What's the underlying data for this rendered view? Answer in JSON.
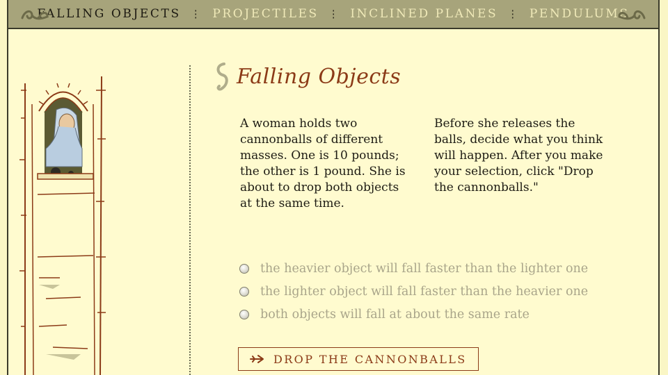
{
  "nav": {
    "items": [
      {
        "label": "FALLING OBJECTS",
        "active": true
      },
      {
        "label": "PROJECTILES",
        "active": false
      },
      {
        "label": "INCLINED PLANES",
        "active": false
      },
      {
        "label": "PENDULUMS",
        "active": false
      }
    ],
    "separator": "⋮"
  },
  "main": {
    "title": "Falling Objects",
    "paragraph1": "A woman holds two cannonballs of different masses. One is 10 pounds; the other is 1 pound. She is about to drop both objects at the same time.",
    "paragraph2": "Before she releases the balls, decide what you think will happen. After you make your selection, click \"Drop the cannonballs.\"",
    "options": [
      "the heavier object will fall faster than the lighter one",
      "the lighter object will fall faster than the heavier one",
      "both objects will fall at about the same rate"
    ],
    "button_label": "DROP THE CANNONBALLS"
  },
  "colors": {
    "background": "#fffbcf",
    "nav_bar": "#a7a47b",
    "title": "#8b3a17",
    "option_text": "#a9a58a"
  },
  "icons": [
    "flourish-icon",
    "title-ornament-icon",
    "arrow-right-icon",
    "radio-icon"
  ]
}
